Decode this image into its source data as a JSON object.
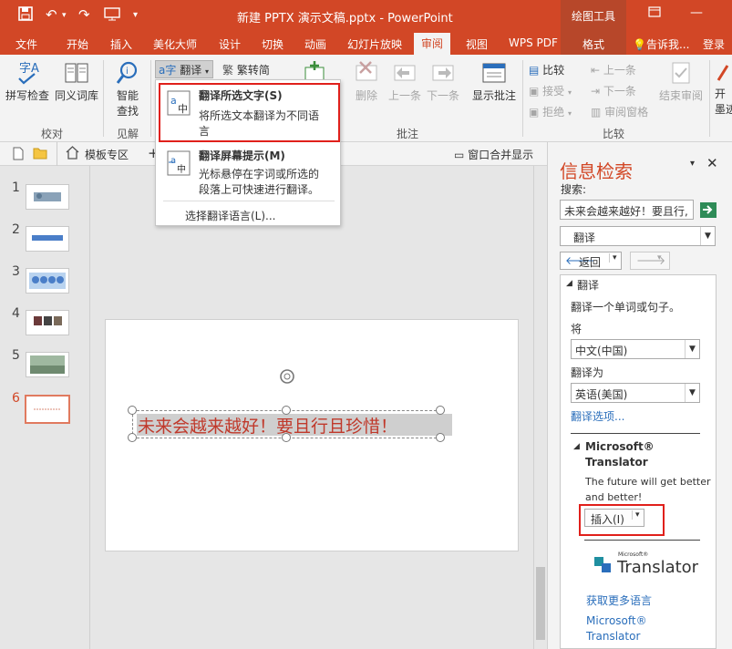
{
  "titlebar": {
    "title": "新建 PPTX 演示文稿.pptx - PowerPoint",
    "context_tab_group": "绘图工具"
  },
  "tabs": [
    "文件",
    "开始",
    "插入",
    "美化大师",
    "设计",
    "切换",
    "动画",
    "幻灯片放映",
    "审阅",
    "视图",
    "WPS PDF",
    "格式"
  ],
  "tell_me": "告诉我...",
  "login": "登录",
  "ribbon": {
    "spell_check": "拼写检查",
    "thesaurus": "同义词库",
    "smart_lookup_1": "智能",
    "smart_lookup_2": "查找",
    "translate": "翻译",
    "convert_simplified": "繁转简",
    "delete": "删除",
    "previous": "上一条",
    "next": "下一条",
    "show_comments": "显示批注",
    "compare": "比较",
    "accept": "接受",
    "reject": "拒绝",
    "prev_change": "上一条",
    "next_change": "下一条",
    "review_pane": "审阅窗格",
    "end_review": "结束审阅",
    "group_proofing": "校对",
    "group_insights": "见解",
    "group_comments": "批注",
    "group_compare": "比较",
    "cut_off_1": "开",
    "cut_off_2": "墨迹"
  },
  "translate_menu": {
    "item1_title": "翻译所选文字(S)",
    "item1_desc1": "将所选文本翻译为不同语",
    "item1_desc2": "言",
    "item2_title": "翻译屏幕提示(M)",
    "item2_desc1": "光标悬停在字词或所选的",
    "item2_desc2": "段落上可快速进行翻译。",
    "item3": "选择翻译语言(L)..."
  },
  "toolbar_row": {
    "template_zone": "模板专区",
    "merge_windows": "窗口合并显示"
  },
  "slides": [
    "1",
    "2",
    "3",
    "4",
    "5",
    "6"
  ],
  "slide": {
    "text": "未来会越来越好！要且行且珍惜！"
  },
  "research_pane": {
    "title": "信息检索",
    "search_label": "搜索:",
    "search_value": "未来会越来越好！要且行,",
    "source": "翻译",
    "back": "返回",
    "section": "翻译",
    "instruction": "翻译一个单词或句子。",
    "from_label": "将",
    "from_lang": "中文(中国)",
    "to_label": "翻译为",
    "to_lang": "英语(美国)",
    "options_link": "翻译选项...",
    "provider": "Microsoft®",
    "provider_2": "Translator",
    "result_1": "The future will get better",
    "result_2": "and better!",
    "insert": "插入(I)",
    "logo_top": "Microsoft®",
    "logo_text": "Translator",
    "more_langs": "获取更多语言",
    "footer_1": "Microsoft®",
    "footer_2": "Translator"
  },
  "colors": {
    "brand": "#d24726",
    "highlight_box": "#e0201b",
    "link": "#2a6ebb",
    "slide_text": "#c0392b"
  }
}
